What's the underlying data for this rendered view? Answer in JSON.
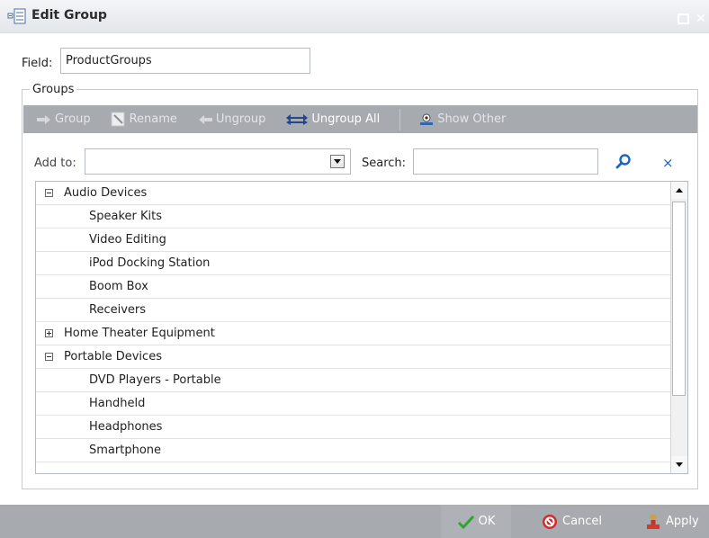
{
  "window": {
    "title": "Edit Group"
  },
  "field": {
    "label": "Field:",
    "value": "ProductGroups"
  },
  "groups_legend": "Groups",
  "toolbar": {
    "group": "Group",
    "rename": "Rename",
    "ungroup": "Ungroup",
    "ungroup_all": "Ungroup All",
    "show_other": "Show Other"
  },
  "addto": {
    "label": "Add to:",
    "value": ""
  },
  "search": {
    "label": "Search:",
    "value": "",
    "clear": "×"
  },
  "tree": {
    "rows": [
      {
        "label": "Audio Devices",
        "level": 0,
        "expander": "minus"
      },
      {
        "label": "Speaker Kits",
        "level": 1
      },
      {
        "label": "Video Editing",
        "level": 1
      },
      {
        "label": "iPod Docking Station",
        "level": 1
      },
      {
        "label": "Boom Box",
        "level": 1
      },
      {
        "label": "Receivers",
        "level": 1
      },
      {
        "label": "Home Theater Equipment",
        "level": 0,
        "expander": "plus"
      },
      {
        "label": "Portable Devices",
        "level": 0,
        "expander": "minus"
      },
      {
        "label": "DVD Players - Portable",
        "level": 1
      },
      {
        "label": "Handheld",
        "level": 1
      },
      {
        "label": "Headphones",
        "level": 1
      },
      {
        "label": "Smartphone",
        "level": 1
      }
    ]
  },
  "footer": {
    "ok": "OK",
    "cancel": "Cancel",
    "apply": "Apply"
  },
  "colors": {
    "toolbar_bg": "#a7aaaf",
    "accent_blue": "#1a66c2",
    "ok_green": "#2fa52f",
    "cancel_red": "#d22b2b"
  }
}
